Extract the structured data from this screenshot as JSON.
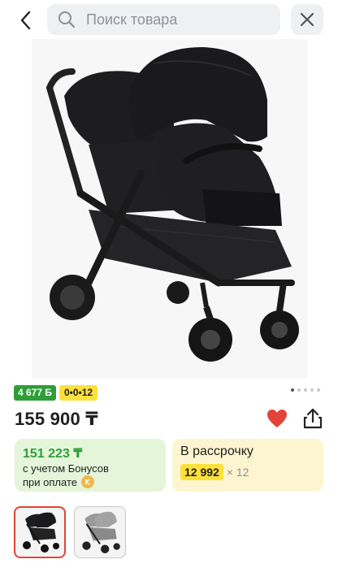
{
  "header": {
    "search_placeholder": "Поиск товара"
  },
  "product": {
    "image_icon": "stroller-image",
    "image_count": 5,
    "active_image_index": 1,
    "badges": {
      "bonus": "4 677 Б",
      "installment_code": "0•0•12"
    },
    "price": "155 900 ₸",
    "favorite": true
  },
  "bonus_offer": {
    "amount": "151 223 ₸",
    "line1": "с учетом Бонусов",
    "line2": "при оплате"
  },
  "installment": {
    "title": "В рассрочку",
    "amount": "12 992",
    "multiplier": "× 12"
  },
  "colors": {
    "accent_green": "#2e9e3a",
    "accent_yellow": "#fde13a",
    "favorite_red": "#e2443a"
  },
  "variants": [
    {
      "name": "black",
      "selected": true
    },
    {
      "name": "grey",
      "selected": false
    }
  ]
}
